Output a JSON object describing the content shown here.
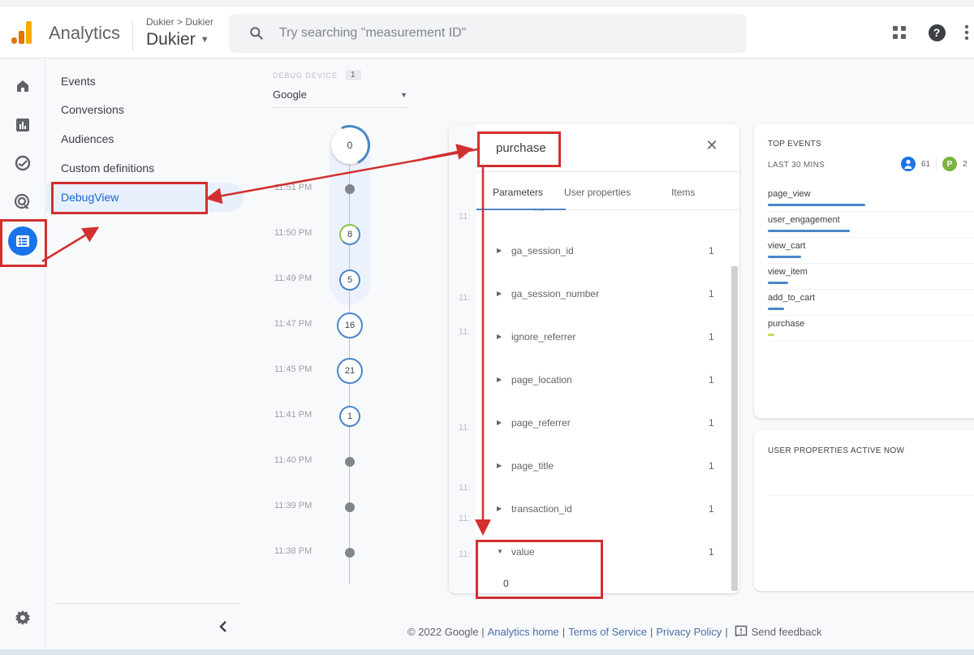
{
  "header": {
    "app_name": "Analytics",
    "breadcrumb": "Dukier > Dukier",
    "property_name": "Dukier",
    "search_placeholder": "Try searching \"measurement ID\""
  },
  "rail": {
    "items": [
      "home",
      "reports",
      "explore",
      "advertising",
      "configure"
    ],
    "active": "configure"
  },
  "subnav": {
    "items": [
      {
        "label": "Events"
      },
      {
        "label": "Conversions"
      },
      {
        "label": "Audiences"
      },
      {
        "label": "Custom definitions"
      },
      {
        "label": "DebugView"
      }
    ],
    "selected": "DebugView"
  },
  "device_selector": {
    "label": "DEBUG DEVICE",
    "count": "1",
    "selected": "Google"
  },
  "timeline": {
    "top_count": "0",
    "rows": [
      {
        "time": "11:51 PM",
        "count": null
      },
      {
        "time": "11:50 PM",
        "count": "8"
      },
      {
        "time": "11:49 PM",
        "count": "5"
      },
      {
        "time": "11:47 PM",
        "count": "16"
      },
      {
        "time": "11:45 PM",
        "count": "21"
      },
      {
        "time": "11:41 PM",
        "count": "1"
      },
      {
        "time": "11:40 PM",
        "count": null
      },
      {
        "time": "11:39 PM",
        "count": null
      },
      {
        "time": "11:38 PM",
        "count": null
      }
    ]
  },
  "event_panel": {
    "title": "purchase",
    "tabs": [
      "Parameters",
      "User properties",
      "Items"
    ],
    "active_tab": "Parameters",
    "partial_row": "debug_mode",
    "parameters": [
      {
        "name": "ga_session_id",
        "count": "1",
        "expanded": false
      },
      {
        "name": "ga_session_number",
        "count": "1",
        "expanded": false
      },
      {
        "name": "ignore_referrer",
        "count": "1",
        "expanded": false
      },
      {
        "name": "page_location",
        "count": "1",
        "expanded": false
      },
      {
        "name": "page_referrer",
        "count": "1",
        "expanded": false
      },
      {
        "name": "page_title",
        "count": "1",
        "expanded": false
      },
      {
        "name": "transaction_id",
        "count": "1",
        "expanded": false
      },
      {
        "name": "value",
        "count": "1",
        "expanded": true,
        "value": "0"
      }
    ],
    "ghost_time_prefix": "11:"
  },
  "top_events": {
    "title": "TOP EVENTS",
    "subtitle": "LAST 30 MINS",
    "users_count": "61",
    "conversions_count": "2",
    "events": [
      {
        "name": "page_view",
        "share": 1.0,
        "color": "#4a86c8"
      },
      {
        "name": "user_engagement",
        "share": 0.84,
        "color": "#4a86c8"
      },
      {
        "name": "view_cart",
        "share": 0.34,
        "color": "#4a86c8"
      },
      {
        "name": "view_item",
        "share": 0.21,
        "color": "#4a86c8"
      },
      {
        "name": "add_to_cart",
        "share": 0.17,
        "color": "#4a86c8"
      },
      {
        "name": "purchase",
        "share": 0.07,
        "color": "#c6d85a"
      }
    ]
  },
  "user_properties": {
    "title": "USER PROPERTIES ACTIVE NOW"
  },
  "footer": {
    "copyright": "© 2022 Google |",
    "links": [
      "Analytics home",
      "Terms of Service",
      "Privacy Policy"
    ],
    "separator": "|",
    "feedback": "Send feedback"
  },
  "colors": {
    "accent": "#1a73e8",
    "annotation": "#d32f2f",
    "timeline_ring": "#4a86c8"
  }
}
